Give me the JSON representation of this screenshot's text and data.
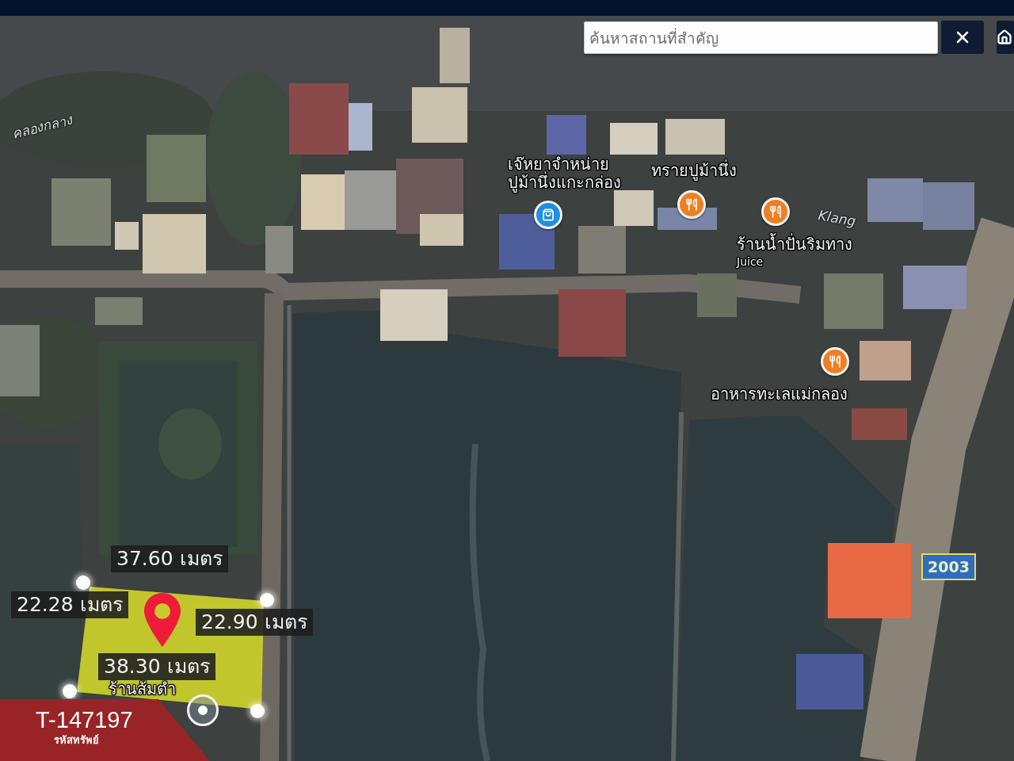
{
  "search": {
    "placeholder": "ค้นหาสถานที่สำคัญ"
  },
  "map": {
    "labels": [
      {
        "kind": "area",
        "lines": [
          "คลองกลาง"
        ]
      },
      {
        "kind": "place",
        "lines": [
          "เจ๊หยาจำหน่าย",
          "ปูม้านึ่งแกะกล่อง"
        ]
      },
      {
        "kind": "place",
        "lines": [
          "ทรายปูม้านึ่ง"
        ]
      },
      {
        "kind": "area",
        "lines": [
          "Klang"
        ]
      },
      {
        "kind": "place",
        "lines": [
          "ร้านน้ำปั่นริมทาง"
        ]
      },
      {
        "kind": "sub",
        "lines": [
          "Juice"
        ]
      },
      {
        "kind": "place",
        "lines": [
          "อาหารทะเลแม่กลอง"
        ]
      },
      {
        "kind": "place",
        "lines": [
          "ร้านส้มตำ"
        ]
      }
    ],
    "markers": [
      {
        "kind": "shop"
      },
      {
        "kind": "restaurant"
      },
      {
        "kind": "restaurant"
      },
      {
        "kind": "restaurant"
      },
      {
        "kind": "target"
      }
    ],
    "road_shield": "2003",
    "plot": {
      "measurements": [
        "37.60 เมตร",
        "22.28 เมตร",
        "22.90 เมตร",
        "38.30 เมตร"
      ]
    }
  },
  "listing_code": {
    "code": "T-147197",
    "caption": "รหัสทรัพย์"
  }
}
